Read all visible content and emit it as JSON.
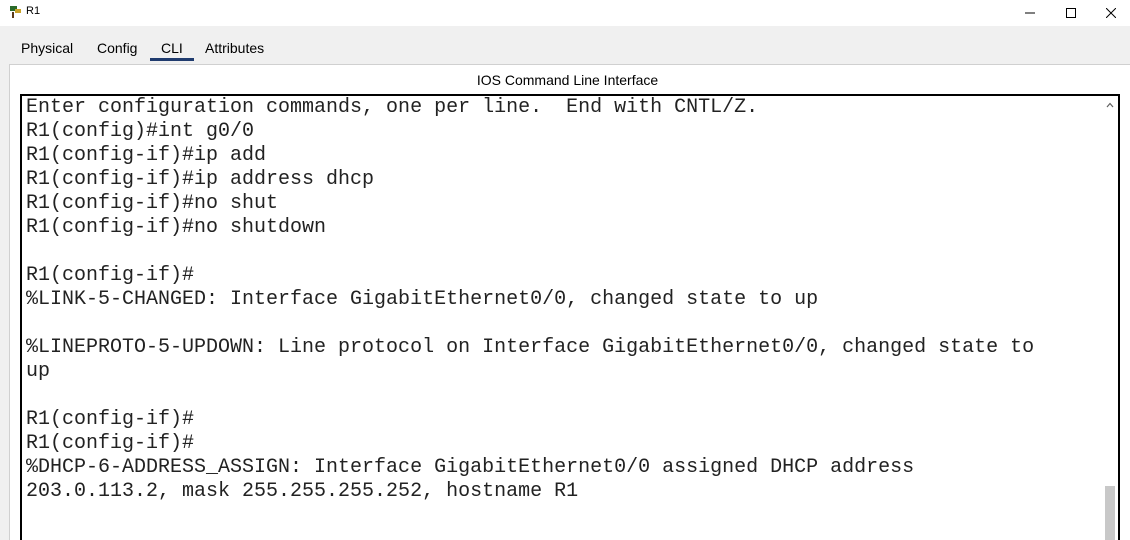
{
  "window": {
    "title": "R1",
    "icon": "router-icon",
    "controls": {
      "minimize": "minimize-icon",
      "maximize": "maximize-icon",
      "close": "close-icon"
    }
  },
  "tabs": [
    {
      "label": "Physical",
      "active": false
    },
    {
      "label": "Config",
      "active": false
    },
    {
      "label": "CLI",
      "active": true
    },
    {
      "label": "Attributes",
      "active": false
    }
  ],
  "panel": {
    "title": "IOS Command Line Interface"
  },
  "terminal": {
    "lines": [
      "Enter configuration commands, one per line.  End with CNTL/Z.",
      "R1(config)#int g0/0",
      "R1(config-if)#ip add",
      "R1(config-if)#ip address dhcp",
      "R1(config-if)#no shut",
      "R1(config-if)#no shutdown",
      "",
      "R1(config-if)#",
      "%LINK-5-CHANGED: Interface GigabitEthernet0/0, changed state to up",
      "",
      "%LINEPROTO-5-UPDOWN: Line protocol on Interface GigabitEthernet0/0, changed state to",
      "up",
      "",
      "R1(config-if)#",
      "R1(config-if)#",
      "%DHCP-6-ADDRESS_ASSIGN: Interface GigabitEthernet0/0 assigned DHCP address",
      "203.0.113.2, mask 255.255.255.252, hostname R1"
    ]
  },
  "colors": {
    "accent_underline": "#1f3b6e",
    "terminal_border": "#000000",
    "terminal_text": "#222222"
  }
}
